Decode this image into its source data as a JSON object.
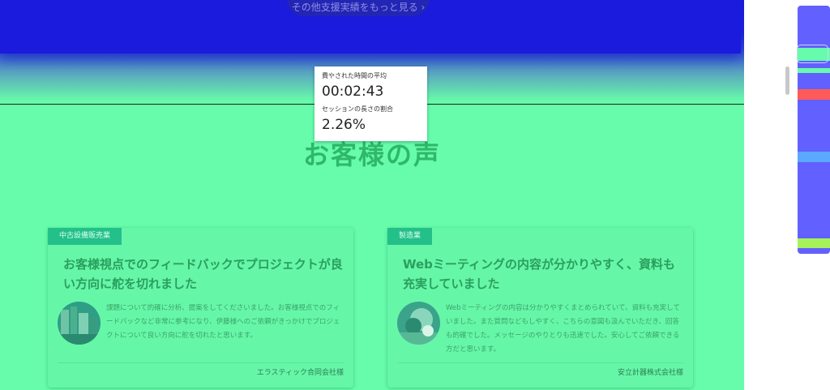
{
  "hero": {
    "cta_label": "その他支援実績をもっと見る ›"
  },
  "tooltip": {
    "avg_time_label": "費やされた時間の平均",
    "avg_time_value": "00:02:43",
    "session_ratio_label": "セッションの長さの割合",
    "session_ratio_value": "2.26%"
  },
  "testimonials": {
    "title": "お客様の声",
    "cards": [
      {
        "tag": "中古設備販売業",
        "title": "お客様視点でのフィードバックでプロジェクトが良い方向に舵を切れました",
        "body": "課題について的確に分析、提案をしてくださいました。お客様視点でのフィードバックなど非常に参考になり、伊藤様へのご依頼がきっかけでプロジェクトについて良い方向に舵を切れたと思います。",
        "company": "エラスティック合同会社様"
      },
      {
        "tag": "製造業",
        "title": "Webミーティングの内容が分かりやすく、資料も充実していました",
        "body": "Webミーティングの内容は分かりやすくまとめられていて、資料も充実していました。また質問などもしやすく、こちらの意図も汲んでいただき、回答も的確でした。メッセージのやりとりも迅速でした。安心してご依頼できる方だと思います。",
        "company": "安立計器株式会社様"
      }
    ]
  },
  "colors": {
    "heatmap_cool": "#6260fe",
    "heatmap_green": "#66fcab",
    "heatmap_red": "#ff5a5a",
    "heatmap_lime": "#a6f25a",
    "heatmap_sky": "#5aa8ff"
  }
}
